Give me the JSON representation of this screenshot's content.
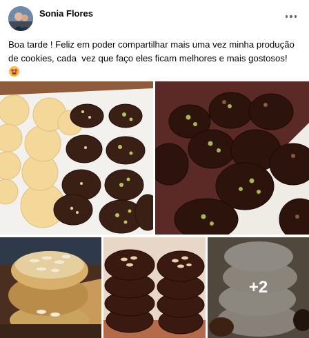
{
  "post": {
    "author": "Sonia Flores",
    "text": "Boa tarde ! Feliz em poder compartilhar mais uma vez minha produção de cookies, cada  vez que faço eles ficam melhores e mais gostosos!",
    "emoji": "smiling-face-with-heart-eyes",
    "more_photos_label": "+2"
  },
  "photos": [
    {
      "subject": "plain butter cookies and chocolate cookies with pistachio on a white tray"
    },
    {
      "subject": "chocolate-dipped cookies with pistachio topping"
    },
    {
      "subject": "stacked cookies with sliced almonds"
    },
    {
      "subject": "stacked chocolate cookies with almonds"
    },
    {
      "subject": "stacked white cookies"
    }
  ],
  "colors": {
    "text": "#050505",
    "secondary": "#65676b",
    "background": "#ffffff"
  }
}
